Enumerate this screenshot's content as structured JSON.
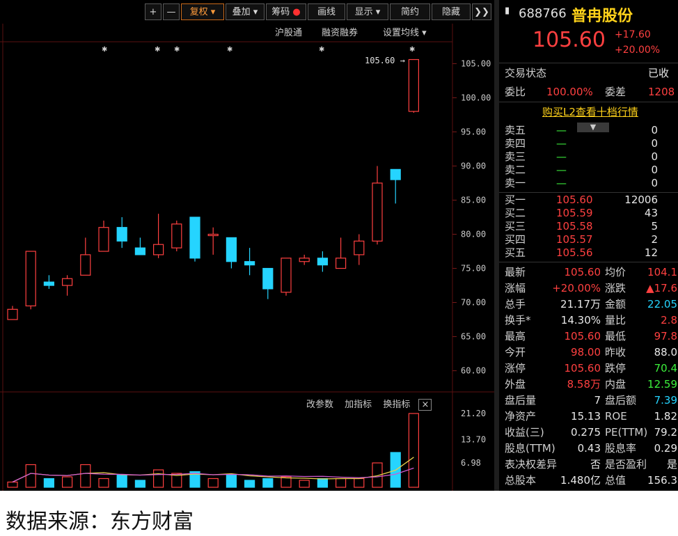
{
  "toolbar": {
    "plus": "+",
    "minus": "—",
    "restore": "复权",
    "overlay": "叠加",
    "chips": "筹码",
    "draw": "画线",
    "display": "显示",
    "simple": "简约",
    "hide": "隐藏",
    "more": "❯❯"
  },
  "subbar": {
    "hsgt": "沪股通",
    "margin": "融资融券",
    "ma_settings": "设置均线"
  },
  "price_chart": {
    "y_ticks": [
      "105.00",
      "100.00",
      "95.00",
      "90.00",
      "85.00",
      "80.00",
      "75.00",
      "70.00",
      "65.00",
      "60.00"
    ],
    "last_price_label": "105.60"
  },
  "volume_chart": {
    "buttons": [
      "改参数",
      "加指标",
      "换指标"
    ],
    "close_icon": "×",
    "y_ticks": [
      "21.20",
      "13.70",
      "6.98"
    ]
  },
  "chart_data": {
    "type": "candlestick",
    "y_range": [
      57,
      108
    ],
    "candles": [
      {
        "o": 67.5,
        "c": 69.0,
        "h": 69.5,
        "l": 67.5
      },
      {
        "o": 69.5,
        "c": 77.5,
        "h": 77.5,
        "l": 69.0
      },
      {
        "o": 73.0,
        "c": 72.5,
        "h": 74.0,
        "l": 72.0
      },
      {
        "o": 72.5,
        "c": 73.5,
        "h": 74.0,
        "l": 71.0
      },
      {
        "o": 74.0,
        "c": 77.0,
        "h": 79.5,
        "l": 74.0
      },
      {
        "o": 77.5,
        "c": 81.0,
        "h": 82.0,
        "l": 77.5
      },
      {
        "o": 81.0,
        "c": 79.0,
        "h": 82.5,
        "l": 78.0
      },
      {
        "o": 78.0,
        "c": 77.0,
        "h": 79.5,
        "l": 77.0
      },
      {
        "o": 77.0,
        "c": 78.5,
        "h": 83.0,
        "l": 76.5
      },
      {
        "o": 78.0,
        "c": 81.5,
        "h": 82.0,
        "l": 77.5
      },
      {
        "o": 82.5,
        "c": 76.5,
        "h": 82.5,
        "l": 76.0
      },
      {
        "o": 80.0,
        "c": 80.0,
        "h": 81.0,
        "l": 77.0
      },
      {
        "o": 79.5,
        "c": 76.0,
        "h": 79.5,
        "l": 75.0
      },
      {
        "o": 76.0,
        "c": 75.5,
        "h": 78.0,
        "l": 74.0
      },
      {
        "o": 75.0,
        "c": 72.0,
        "h": 75.0,
        "l": 70.5
      },
      {
        "o": 71.5,
        "c": 76.5,
        "h": 76.5,
        "l": 71.0
      },
      {
        "o": 76.0,
        "c": 76.5,
        "h": 77.0,
        "l": 75.5
      },
      {
        "o": 76.5,
        "c": 75.5,
        "h": 77.5,
        "l": 74.5
      },
      {
        "o": 75.0,
        "c": 76.5,
        "h": 79.5,
        "l": 75.0
      },
      {
        "o": 77.0,
        "c": 79.0,
        "h": 80.0,
        "l": 75.5
      },
      {
        "o": 79.0,
        "c": 87.5,
        "h": 90.0,
        "l": 78.5
      },
      {
        "o": 89.5,
        "c": 88.0,
        "h": 89.5,
        "l": 84.5
      },
      {
        "o": 98.0,
        "c": 105.6,
        "h": 105.6,
        "l": 97.8
      }
    ],
    "volumes": [
      1.5,
      6.5,
      2.5,
      3.0,
      6.5,
      2.5,
      3.5,
      2.0,
      5.0,
      4.0,
      4.5,
      2.5,
      3.5,
      2.0,
      2.5,
      3.0,
      2.0,
      2.5,
      2.5,
      2.5,
      7.0,
      10.0,
      21.2
    ],
    "ma_series": [
      "MA5",
      "MA10"
    ]
  },
  "quote": {
    "code": "688766",
    "name": "普冉股份",
    "price": "105.60",
    "change": "+17.60",
    "change_pct": "+20.00%",
    "status_label": "交易状态",
    "status_value": "已收",
    "weibi_label": "委比",
    "weibi_value": "100.00%",
    "weicha_label": "委差",
    "weicha_value": "1208",
    "l2_link": "购买L2查看十档行情",
    "sell": [
      {
        "label": "卖五",
        "price": "—",
        "vol": "0"
      },
      {
        "label": "卖四",
        "price": "—",
        "vol": "0"
      },
      {
        "label": "卖三",
        "price": "—",
        "vol": "0"
      },
      {
        "label": "卖二",
        "price": "—",
        "vol": "0"
      },
      {
        "label": "卖一",
        "price": "—",
        "vol": "0"
      }
    ],
    "buy": [
      {
        "label": "买一",
        "price": "105.60",
        "vol": "12006"
      },
      {
        "label": "买二",
        "price": "105.59",
        "vol": "43"
      },
      {
        "label": "买三",
        "price": "105.58",
        "vol": "5"
      },
      {
        "label": "买四",
        "price": "105.57",
        "vol": "2"
      },
      {
        "label": "买五",
        "price": "105.56",
        "vol": "12"
      }
    ],
    "stats": [
      {
        "l1": "最新",
        "v1": "105.60",
        "c1": "red",
        "l2": "均价",
        "v2": "104.1",
        "c2": "red"
      },
      {
        "l1": "涨幅",
        "v1": "+20.00%",
        "c1": "red",
        "l2": "涨跌",
        "v2": "▲17.6",
        "c2": "red"
      },
      {
        "l1": "总手",
        "v1": "21.17万",
        "c1": "white",
        "l2": "金额",
        "v2": "22.05",
        "c2": "cyan"
      },
      {
        "l1": "换手*",
        "v1": "14.30%",
        "c1": "white",
        "l2": "量比",
        "v2": "2.8",
        "c2": "red"
      },
      {
        "l1": "最高",
        "v1": "105.60",
        "c1": "red",
        "l2": "最低",
        "v2": "97.8",
        "c2": "red"
      },
      {
        "l1": "今开",
        "v1": "98.00",
        "c1": "red",
        "l2": "昨收",
        "v2": "88.0",
        "c2": "white"
      },
      {
        "l1": "涨停",
        "v1": "105.60",
        "c1": "red",
        "l2": "跌停",
        "v2": "70.4",
        "c2": "green"
      },
      {
        "l1": "外盘",
        "v1": "8.58万",
        "c1": "red",
        "l2": "内盘",
        "v2": "12.59",
        "c2": "green"
      },
      {
        "l1": "盘后量",
        "v1": "7",
        "c1": "white",
        "l2": "盘后额",
        "v2": "7.39",
        "c2": "cyan"
      },
      {
        "l1": "净资产",
        "v1": "15.13",
        "c1": "white",
        "l2": "ROE",
        "v2": "1.82",
        "c2": "white"
      },
      {
        "l1": "收益(三)",
        "v1": "0.275",
        "c1": "white",
        "l2": "PE(TTM)",
        "v2": "79.2",
        "c2": "white"
      },
      {
        "l1": "股息(TTM)",
        "v1": "0.43",
        "c1": "white",
        "l2": "股息率",
        "v2": "0.29",
        "c2": "white"
      },
      {
        "l1": "表决权差异",
        "v1": "否",
        "c1": "white",
        "l2": "是否盈利",
        "v2": "是",
        "c2": "white"
      },
      {
        "l1": "总股本",
        "v1": "1.480亿",
        "c1": "white",
        "l2": "总值",
        "v2": "156.3",
        "c2": "white"
      }
    ]
  },
  "caption": "数据来源：东方财富",
  "colors": {
    "up": "#ff4040",
    "down": "#25d4ff",
    "ma5": "#e8d24a",
    "ma10": "#d05ad0"
  }
}
